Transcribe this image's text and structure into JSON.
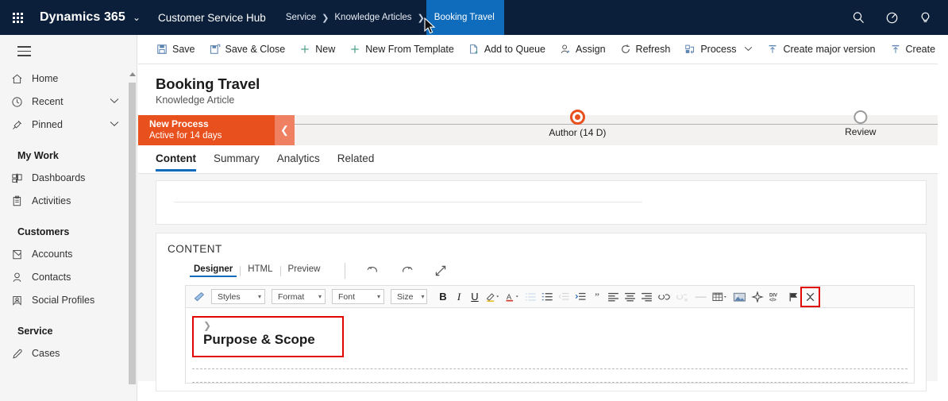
{
  "topnav": {
    "waffle_label": "app-launcher",
    "brand": "Dynamics 365",
    "brand_chevron": "⌄",
    "app_title": "Customer Service Hub",
    "breadcrumbs": [
      {
        "label": "Service",
        "current": false
      },
      {
        "label": "Knowledge Articles",
        "current": false
      },
      {
        "label": "Booking Travel",
        "current": true
      }
    ],
    "separator": "❯",
    "icons": [
      {
        "name": "search-icon",
        "title": "Search"
      },
      {
        "name": "assistant-icon",
        "title": "Assistant"
      },
      {
        "name": "help-icon",
        "title": "Help"
      }
    ]
  },
  "sidebar": {
    "hamburger_label": "Site Map",
    "items": [
      {
        "label": "Home",
        "icon": "home-icon",
        "chevron": ""
      },
      {
        "label": "Recent",
        "icon": "clock-icon",
        "chevron": "⌄"
      },
      {
        "label": "Pinned",
        "icon": "pin-icon",
        "chevron": "⌄"
      }
    ],
    "groups": [
      {
        "title": "My Work",
        "items": [
          {
            "label": "Dashboards",
            "icon": "dashboard-icon"
          },
          {
            "label": "Activities",
            "icon": "activities-icon"
          }
        ]
      },
      {
        "title": "Customers",
        "items": [
          {
            "label": "Accounts",
            "icon": "account-icon"
          },
          {
            "label": "Contacts",
            "icon": "contact-icon"
          },
          {
            "label": "Social Profiles",
            "icon": "social-profile-icon"
          }
        ]
      },
      {
        "title": "Service",
        "items": [
          {
            "label": "Cases",
            "icon": "case-icon"
          }
        ]
      }
    ]
  },
  "commandbar": {
    "commands": [
      {
        "label": "Save",
        "icon": "save-icon"
      },
      {
        "label": "Save & Close",
        "icon": "save-close-icon"
      },
      {
        "label": "New",
        "icon": "plus-icon"
      },
      {
        "label": "New From Template",
        "icon": "plus-icon"
      },
      {
        "label": "Add to Queue",
        "icon": "add-to-queue-icon"
      },
      {
        "label": "Assign",
        "icon": "assign-icon"
      },
      {
        "label": "Refresh",
        "icon": "refresh-icon"
      },
      {
        "label": "Process",
        "icon": "process-icon",
        "chevron": "⌄"
      },
      {
        "label": "Create major version",
        "icon": "major-version-icon"
      },
      {
        "label": "Create minor ",
        "icon": "minor-version-icon"
      }
    ]
  },
  "record": {
    "title": "Booking Travel",
    "subtitle": "Knowledge Article"
  },
  "process_flow": {
    "stage_name": "New Process",
    "stage_status": "Active for 14 days",
    "collapse_glyph": "❮",
    "accent_color": "#e8501e",
    "stages": [
      {
        "label": "Author",
        "duration": "(14 D)",
        "state": "active"
      },
      {
        "label": "Review",
        "duration": "",
        "state": "idle"
      }
    ]
  },
  "tabs": [
    {
      "label": "Content",
      "active": true
    },
    {
      "label": "Summary",
      "active": false
    },
    {
      "label": "Analytics",
      "active": false
    },
    {
      "label": "Related",
      "active": false
    }
  ],
  "content_section": {
    "section_title": "CONTENT",
    "editor_tabs": [
      {
        "label": "Designer",
        "active": true
      },
      {
        "label": "HTML",
        "active": false
      },
      {
        "label": "Preview",
        "active": false
      }
    ],
    "editor_tools": [
      {
        "name": "undo-icon",
        "title": "Undo"
      },
      {
        "name": "redo-icon",
        "title": "Redo"
      },
      {
        "name": "expand-icon",
        "title": "Expand"
      }
    ],
    "rte_toolbar": {
      "selects": [
        {
          "name": "styles-select",
          "value": "Styles",
          "caret": "▾"
        },
        {
          "name": "format-select",
          "value": "Format",
          "caret": "▾"
        },
        {
          "name": "font-select",
          "value": "Font",
          "caret": "▾"
        },
        {
          "name": "size-select",
          "value": "Size",
          "caret": "▾"
        }
      ],
      "format_painter": "format-painter-icon",
      "buttons": [
        {
          "name": "bold-button",
          "glyph": "B",
          "title": "Bold"
        },
        {
          "name": "italic-button",
          "glyph": "I",
          "title": "Italic"
        },
        {
          "name": "underline-button",
          "glyph": "U",
          "title": "Underline"
        },
        {
          "name": "highlight-color-button",
          "glyph": "",
          "title": "Text highlight color"
        },
        {
          "name": "font-color-button",
          "glyph": "A",
          "title": "Font color"
        },
        {
          "name": "bulleted-list-button",
          "glyph": "",
          "title": "Bulleted list"
        },
        {
          "name": "numbered-list-button",
          "glyph": "",
          "title": "Numbered list"
        },
        {
          "name": "decrease-indent-button",
          "glyph": "",
          "title": "Decrease indent"
        },
        {
          "name": "increase-indent-button",
          "glyph": "",
          "title": "Increase indent"
        },
        {
          "name": "blockquote-button",
          "glyph": "",
          "title": "Block quote"
        },
        {
          "name": "align-left-button",
          "glyph": "",
          "title": "Align left"
        },
        {
          "name": "align-center-button",
          "glyph": "",
          "title": "Center"
        },
        {
          "name": "align-right-button",
          "glyph": "",
          "title": "Align right"
        },
        {
          "name": "insert-link-button",
          "glyph": "",
          "title": "Link"
        },
        {
          "name": "unlink-button",
          "glyph": "",
          "title": "Unlink"
        },
        {
          "name": "horizontal-rule-button",
          "glyph": "",
          "title": "Horizontal line"
        },
        {
          "name": "insert-table-button",
          "glyph": "",
          "title": "Table",
          "caret": "▾"
        },
        {
          "name": "insert-image-button",
          "glyph": "",
          "title": "Image"
        },
        {
          "name": "smart-assist-button",
          "glyph": "",
          "title": "Smart assist"
        },
        {
          "name": "source-code-button",
          "glyph": "",
          "title": "Source code"
        },
        {
          "name": "insert-flag-button",
          "glyph": "",
          "title": "Flag"
        },
        {
          "name": "collapse-toolbar-button",
          "glyph": "",
          "title": "Collapse toolbar",
          "highlighted": true
        }
      ]
    },
    "body": {
      "heading_chevron": "❯",
      "heading": "Purpose & Scope",
      "highlighted": true
    }
  },
  "colors": {
    "nav_bg": "#0b1f3a",
    "crumb_active_bg": "#0f6cbd",
    "bpf_orange": "#e8501e",
    "tab_underline": "#0f6cbd",
    "highlight_red": "#e10600"
  }
}
